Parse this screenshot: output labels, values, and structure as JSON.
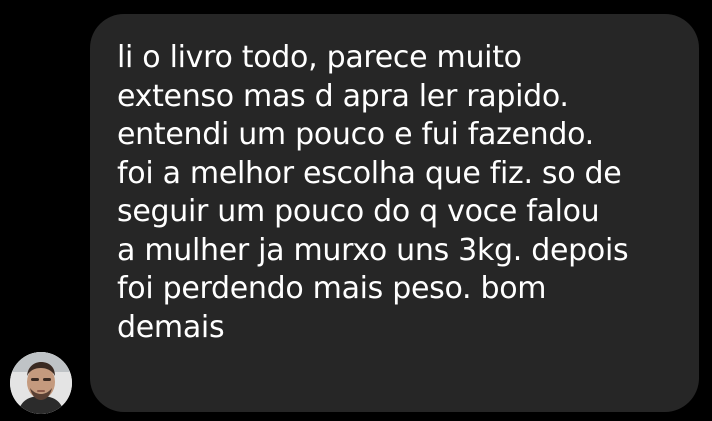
{
  "conversation": {
    "sender_avatar_icon": "user-avatar-photo",
    "message": {
      "lines": [
        "li o livro todo, parece muito",
        "extenso mas d apra ler rapido.",
        "entendi um pouco e fui fazendo.",
        "foi a melhor escolha que fiz. so de",
        "seguir um pouco do q voce falou",
        "a mulher ja murxo uns 3kg. depois",
        "foi perdendo mais peso. bom",
        "demais"
      ]
    }
  },
  "colors": {
    "background": "#000000",
    "bubble": "#262626",
    "text": "#ffffff"
  }
}
